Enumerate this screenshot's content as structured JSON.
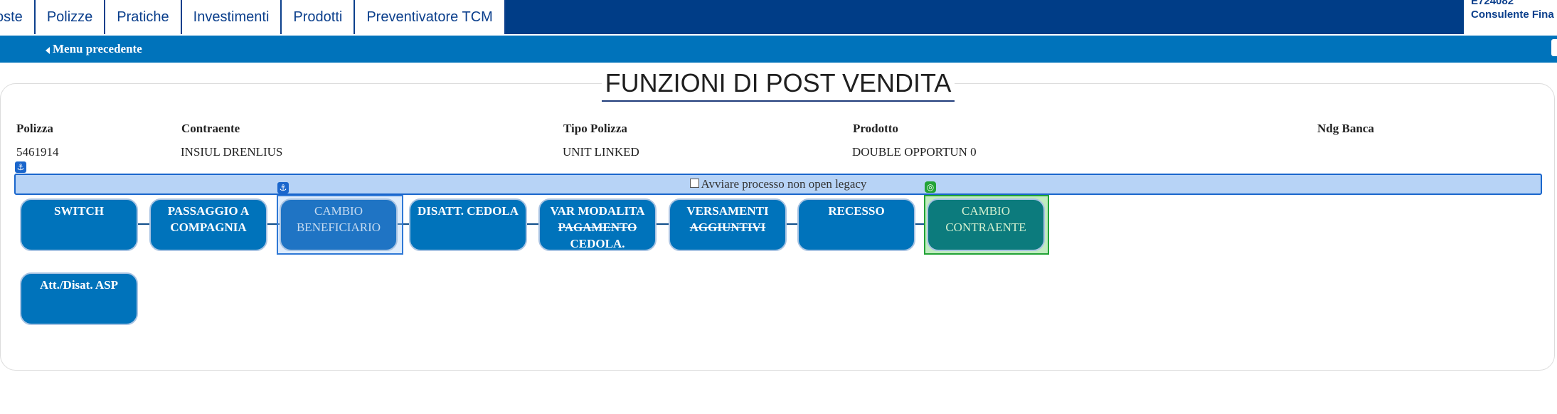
{
  "nav": {
    "tabs": [
      "oste",
      "Polizze",
      "Pratiche",
      "Investimenti",
      "Prodotti",
      "Preventivatore TCM"
    ]
  },
  "user": {
    "id": "E724082",
    "role": "Consulente Fina"
  },
  "subnav": {
    "back_label": "Menu precedente"
  },
  "page": {
    "title": "FUNZIONI DI POST VENDITA"
  },
  "policy": {
    "headers": {
      "polizza": "Polizza",
      "contraente": "Contraente",
      "tipo": "Tipo Polizza",
      "prodotto": "Prodotto",
      "ndg": "Ndg Banca"
    },
    "values": {
      "polizza": "5461914",
      "contraente": "INSIUL DRENLIUS",
      "tipo": "UNIT LINKED",
      "prodotto": "DOUBLE OPPORTUN 0",
      "ndg": ""
    }
  },
  "legacy": {
    "label": "Avviare processo non open legacy",
    "checked": false
  },
  "functions": {
    "switch": "SWITCH",
    "passaggio": "PASSAGGIO A COMPAGNIA",
    "cambio_beneficiario": "CAMBIO BENEFICIARIO",
    "disatt_cedola": "DISATT. CEDOLA",
    "var_modalita_1": "VAR MODALITA",
    "var_modalita_2": "PAGAMENTO",
    "var_modalita_3": "CEDOLA.",
    "versamenti_1": "VERSAMENTI",
    "versamenti_2": "AGGIUNTIVI",
    "recesso": "RECESSO",
    "cambio_contraente": "CAMBIO CONTRAENTE",
    "asp": "Att./Disat. ASP"
  },
  "colors": {
    "top_nav": "#003d87",
    "sub_nav": "#0073bb",
    "button": "#0073bb",
    "legacy_bar": "#b7d3f6",
    "selected_teal": "#0c7b7d"
  }
}
